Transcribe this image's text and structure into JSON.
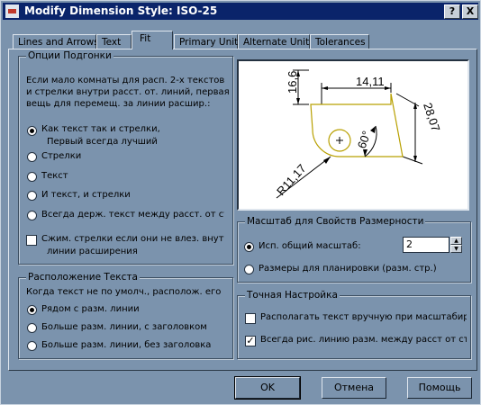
{
  "window": {
    "title": "Modify Dimension Style: ISO-25",
    "help_btn": "?",
    "close_btn": "X"
  },
  "tabs": [
    {
      "label": "Lines and Arrows"
    },
    {
      "label": "Text"
    },
    {
      "label": "Fit"
    },
    {
      "label": "Primary Units"
    },
    {
      "label": "Alternate Units"
    },
    {
      "label": "Tolerances"
    }
  ],
  "fit_options": {
    "legend": "Опции Подгонки",
    "desc": [
      "Если мало комнаты для расп. 2-х текстов",
      "и стрелки внутри расст. от. линий, первая",
      "вещь для перемещ. за линии расшир.:"
    ],
    "radios": [
      {
        "label": "Как текст так и стрелки,",
        "label2": "Первый всегда лучший",
        "selected": true
      },
      {
        "label": "Стрелки",
        "selected": false
      },
      {
        "label": "Текст",
        "selected": false
      },
      {
        "label": "И текст, и стрелки",
        "selected": false
      },
      {
        "label": "Всегда держ. текст между расст. от стр",
        "selected": false
      }
    ],
    "check": {
      "label": "Сжим. стрелки если они не влез. внутрі",
      "label2": "линии расширения",
      "checked": false
    }
  },
  "text_placement": {
    "legend": "Расположение Текста",
    "desc": "Когда текст не по умолч., располож. его",
    "radios": [
      {
        "label": "Рядом с разм. линии",
        "selected": true
      },
      {
        "label": "Больше разм. линии, с заголовком",
        "selected": false
      },
      {
        "label": "Больше разм. линии, без заголовка",
        "selected": false
      }
    ]
  },
  "preview": {
    "dim_top": "14,11",
    "dim_left": "16,6",
    "dim_right": "28,07",
    "dim_angle": "60°",
    "dim_radius": "R11,17"
  },
  "scale": {
    "legend": "Масштаб для Свойств Размерности",
    "radio_overall": "Исп. общий масштаб:",
    "radio_overall_selected": true,
    "value": "2",
    "radio_layout": "Размеры для планировки (разм. стр.)",
    "radio_layout_selected": false
  },
  "fine_tune": {
    "legend": "Точная Настройка",
    "check1": {
      "label": "Располагать текст вручную при масштабир.",
      "checked": false
    },
    "check2": {
      "label": "Всегда рис. линию разм. между расст от стр",
      "checked": true
    }
  },
  "buttons": {
    "ok": "OK",
    "cancel": "Отмена",
    "help": "Помощь"
  },
  "colors": {
    "title_bar": "#0a246a",
    "dialog_bg": "#7b93ad",
    "drawing_shape": "#b8a000"
  }
}
